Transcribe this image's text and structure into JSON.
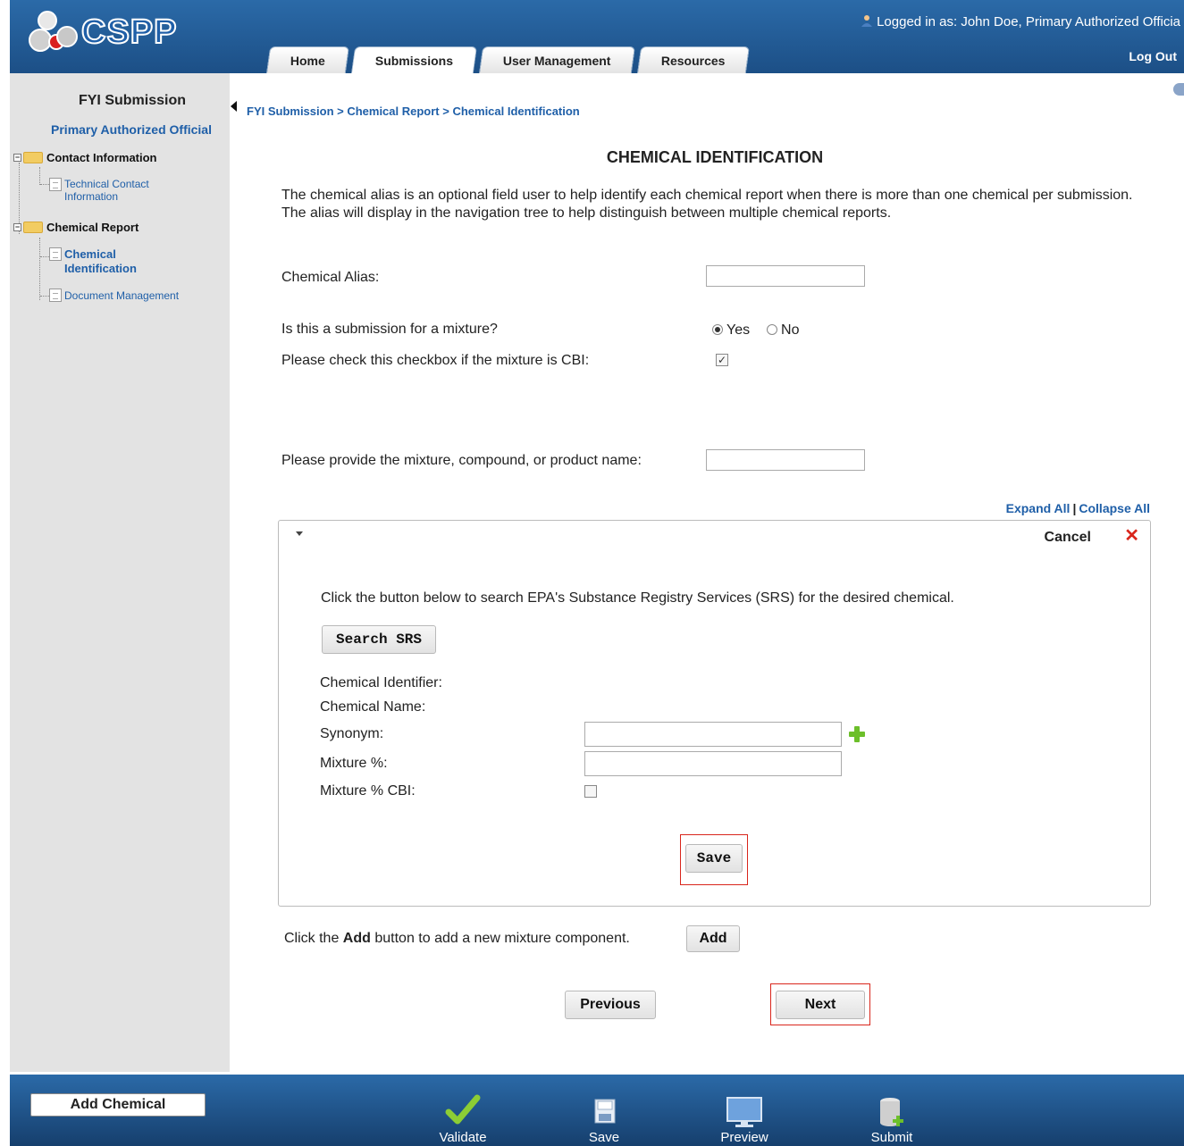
{
  "header": {
    "brand": "CSPP",
    "user_info": "Logged in as: John Doe, Primary Authorized Officia",
    "logout_label": "Log Out",
    "tabs": [
      {
        "label": "Home"
      },
      {
        "label": "Submissions"
      },
      {
        "label": "User Management"
      },
      {
        "label": "Resources"
      }
    ],
    "active_tab": "Submissions"
  },
  "sidebar": {
    "title": "FYI Submission",
    "subtitle": "Primary Authorized Official",
    "tree": {
      "contact_information": "Contact Information",
      "technical_contact_line1": "Technical Contact",
      "technical_contact_line2": "Information",
      "chemical_report": "Chemical Report",
      "chemical_identification_line1": "Chemical",
      "chemical_identification_line2": "Identification",
      "document_management": "Document Management"
    }
  },
  "main": {
    "breadcrumb": "FYI Submission > Chemical Report > Chemical Identification",
    "title": "CHEMICAL IDENTIFICATION",
    "intro": "The chemical alias is an optional field user to help identify each chemical report when there is more than one chemical per submission. The alias will display in the navigation tree to help distinguish between multiple chemical reports.",
    "chemical_alias_label": "Chemical Alias:",
    "chemical_alias_value": "",
    "mixture_question": "Is this a submission for a mixture?",
    "mixture_yes": "Yes",
    "mixture_no": "No",
    "mixture_selected": "Yes",
    "cbi_label": "Please check this checkbox if the mixture is CBI:",
    "cbi_checked": true,
    "product_name_label": "Please provide the mixture, compound, or product name:",
    "product_name_value": "",
    "expand_all": "Expand All",
    "separator": "|",
    "collapse_all": "Collapse All",
    "panel": {
      "cancel_label": "Cancel",
      "close_icon": "close-icon",
      "srs_instructions": "Click the button below to search EPA's Substance Registry Services (SRS) for the desired chemical.",
      "search_srs_label": "Search SRS",
      "chemical_identifier_label": "Chemical Identifier:",
      "chemical_name_label": "Chemical Name:",
      "synonym_label": "Synonym:",
      "synonym_value": "",
      "mixture_pct_label": "Mixture %:",
      "mixture_pct_value": "",
      "mixture_pct_cbi_label": "Mixture % CBI:",
      "mixture_pct_cbi_checked": false,
      "save_label": "Save"
    },
    "add_text_prefix": "Click the ",
    "add_text_bold": "Add",
    "add_text_suffix": " button to add a new mixture component.",
    "add_label": "Add",
    "previous_label": "Previous",
    "next_label": "Next"
  },
  "footer": {
    "add_chemical_label": "Add Chemical",
    "actions": [
      {
        "label": "Validate",
        "icon": "checkmark-icon"
      },
      {
        "label": "Save",
        "icon": "floppy-disk-icon"
      },
      {
        "label": "Preview",
        "icon": "monitor-icon"
      },
      {
        "label": "Submit",
        "icon": "database-add-icon"
      }
    ]
  },
  "colors": {
    "header_blue": "#2b6aa8",
    "link_blue": "#1f5fa8",
    "highlight_red": "#d9261c",
    "sidebar_gray": "#e3e3e3"
  }
}
